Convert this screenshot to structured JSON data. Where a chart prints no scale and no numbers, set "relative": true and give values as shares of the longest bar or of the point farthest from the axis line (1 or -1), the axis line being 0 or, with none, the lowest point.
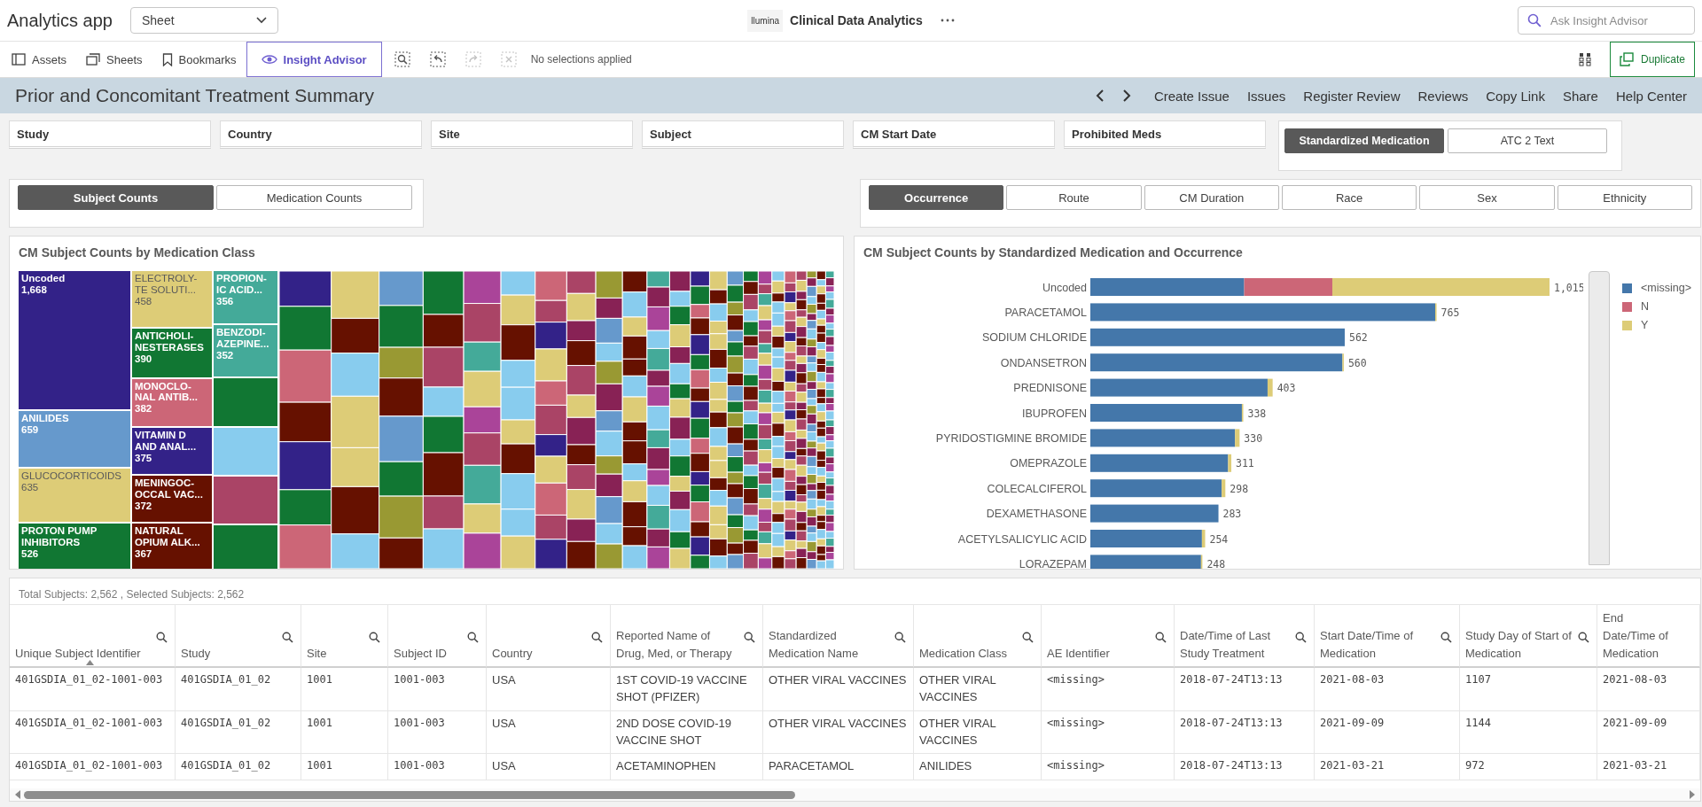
{
  "app": {
    "title": "Analytics app",
    "sheet_select": "Sheet",
    "logo": "llumina",
    "name": "Clinical Data Analytics",
    "search": {
      "placeholder": "Ask Insight Advisor"
    }
  },
  "toolbar": {
    "buttons": [
      {
        "label": "Assets",
        "kind": "assets",
        "selected": false
      },
      {
        "label": "Sheets",
        "kind": "sheets",
        "selected": false
      },
      {
        "label": "Bookmarks",
        "kind": "bookmarks",
        "selected": false
      },
      {
        "label": "Insight Advisor",
        "kind": "insight",
        "selected": true
      }
    ],
    "selection_tools": [
      {
        "kind": "search",
        "disabled": false
      },
      {
        "kind": "back",
        "disabled": false
      },
      {
        "kind": "forward",
        "disabled": true
      },
      {
        "kind": "clear",
        "disabled": true
      }
    ],
    "selection_status": "No selections applied",
    "duplicate": "Duplicate"
  },
  "sheet": {
    "title": "Prior and Concomitant Treatment Summary",
    "links": [
      "Create Issue",
      "Issues",
      "Register Review",
      "Reviews",
      "Copy Link",
      "Share",
      "Help Center"
    ]
  },
  "filters": [
    "Study",
    "Country",
    "Site",
    "Subject",
    "CM Start Date",
    "Prohibited Meds"
  ],
  "dimension_toggle": [
    {
      "label": "Standardized Medication",
      "selected": true
    },
    {
      "label": "ATC 2 Text",
      "selected": false
    }
  ],
  "count_toggle": [
    {
      "label": "Subject Counts",
      "selected": true
    },
    {
      "label": "Medication Counts",
      "selected": false
    }
  ],
  "breakdown_toggle": [
    {
      "label": "Occurrence",
      "selected": true
    },
    {
      "label": "Route",
      "selected": false
    },
    {
      "label": "CM Duration",
      "selected": false
    },
    {
      "label": "Race",
      "selected": false
    },
    {
      "label": "Sex",
      "selected": false
    },
    {
      "label": "Ethnicity",
      "selected": false
    }
  ],
  "treemap": {
    "title": "CM Subject Counts by Medication Class",
    "tiles": [
      {
        "label": "Uncoded",
        "value": "1,668",
        "color": "#332288"
      },
      {
        "label": "ANILIDES",
        "value": "659",
        "color": "#6699cc"
      },
      {
        "label": "GLUCOCORTICOIDS",
        "value": "635",
        "color": "#ddcc77"
      },
      {
        "label": "PROTON PUMP INHIBITORS",
        "value": "526",
        "color": "#117733"
      },
      {
        "label": "ELECTROLY-TE SOLUTI...",
        "value": "458",
        "color": "#ddcc77"
      },
      {
        "label": "ANTICHOLI-NESTERASES",
        "value": "390",
        "color": "#117733"
      },
      {
        "label": "MONOCLO-NAL ANTIB...",
        "value": "382",
        "color": "#cc6677"
      },
      {
        "label": "VITAMIN D AND ANAL...",
        "value": "375",
        "color": "#332288"
      },
      {
        "label": "MENINGOC-OCCAL VAC...",
        "value": "372",
        "color": "#661100"
      },
      {
        "label": "NATURAL OPIUM ALK...",
        "value": "367",
        "color": "#661100"
      },
      {
        "label": "PROPION-IC ACID...",
        "value": "356",
        "color": "#44aa99"
      },
      {
        "label": "BENZODI-AZEPINE...",
        "value": "352",
        "color": "#44aa99"
      }
    ]
  },
  "bar_chart": {
    "chart_data": {
      "type": "bar",
      "orientation": "horizontal",
      "stacked": true,
      "relative": true,
      "value_labels": [
        "1,015",
        "765",
        "562",
        "560",
        "403",
        "338",
        "330",
        "311",
        "298",
        "283",
        "254",
        "248"
      ],
      "title": "CM Subject Counts by Standardized Medication and Occurrence",
      "categories": [
        "Uncoded",
        "PARACETAMOL",
        "SODIUM CHLORIDE",
        "ONDANSETRON",
        "PREDNISONE",
        "IBUPROFEN",
        "PYRIDOSTIGMINE BROMIDE",
        "OMEPRAZOLE",
        "COLECALCIFEROL",
        "DEXAMETHASONE",
        "ACETYLSALICYLIC ACID",
        "LORAZEPAM"
      ],
      "series": [
        {
          "name": "<missing>",
          "color": "#4477aa",
          "values": [
            0.335,
            0.751,
            0.554,
            0.549,
            0.386,
            0.33,
            0.315,
            0.3,
            0.286,
            0.279,
            0.243,
            0.241
          ]
        },
        {
          "name": "N",
          "color": "#cc6677",
          "values": [
            0.192,
            0,
            0,
            0,
            0,
            0,
            0,
            0,
            0,
            0,
            0,
            0
          ]
        },
        {
          "name": "Y",
          "color": "#ddcc77",
          "values": [
            0.473,
            0.003,
            0,
            0.003,
            0.011,
            0.003,
            0.01,
            0.007,
            0.008,
            0,
            0.007,
            0.003
          ]
        }
      ]
    }
  },
  "table": {
    "summary": "Total Subjects: 2,562 , Selected Subjects: 2,562",
    "columns": [
      {
        "header": "Unique Subject Identifier",
        "kind": "code",
        "sorted": true,
        "searchable": true
      },
      {
        "header": "Study",
        "kind": "code",
        "sorted": false,
        "searchable": true
      },
      {
        "header": "Site",
        "kind": "code",
        "sorted": false,
        "searchable": true
      },
      {
        "header": "Subject ID",
        "kind": "code",
        "sorted": false,
        "searchable": true
      },
      {
        "header": "Country",
        "kind": "text",
        "sorted": false,
        "searchable": true
      },
      {
        "header": "Reported Name of Drug, Med, or Therapy",
        "kind": "text",
        "sorted": false,
        "searchable": true
      },
      {
        "header": "Standardized Medication Name",
        "kind": "text",
        "sorted": false,
        "searchable": true
      },
      {
        "header": "Medication Class",
        "kind": "text",
        "sorted": false,
        "searchable": true
      },
      {
        "header": "AE Identifier",
        "kind": "code",
        "sorted": false,
        "searchable": true
      },
      {
        "header": "Date/Time of Last Study Treatment",
        "kind": "code",
        "sorted": false,
        "searchable": true
      },
      {
        "header": "Start Date/Time of Medication",
        "kind": "code",
        "sorted": false,
        "searchable": true
      },
      {
        "header": "Study Day of Start of Medication",
        "kind": "code",
        "sorted": false,
        "searchable": true
      },
      {
        "header": "End Date/Time of Medication",
        "kind": "code",
        "sorted": false,
        "searchable": false
      }
    ],
    "rows": [
      [
        "401GSDIA_01_02-1001-003",
        "401GSDIA_01_02",
        "1001",
        "1001-003",
        "USA",
        "1ST COVID-19 VACCINE SHOT (PFIZER)",
        "OTHER VIRAL VACCINES",
        "OTHER VIRAL VACCINES",
        "<missing>",
        "2018-07-24T13:13",
        "2021-08-03",
        "1107",
        "2021-08-03"
      ],
      [
        "401GSDIA_01_02-1001-003",
        "401GSDIA_01_02",
        "1001",
        "1001-003",
        "USA",
        "2ND DOSE COVID-19 VACCINE SHOT",
        "OTHER VIRAL VACCINES",
        "OTHER VIRAL VACCINES",
        "<missing>",
        "2018-07-24T13:13",
        "2021-09-09",
        "1144",
        "2021-09-09"
      ],
      [
        "401GSDIA_01_02-1001-003",
        "401GSDIA_01_02",
        "1001",
        "1001-003",
        "USA",
        "ACETAMINOPHEN",
        "PARACETAMOL",
        "ANILIDES",
        "<missing>",
        "2018-07-24T13:13",
        "2021-03-21",
        "972",
        "2021-03-21"
      ]
    ]
  }
}
